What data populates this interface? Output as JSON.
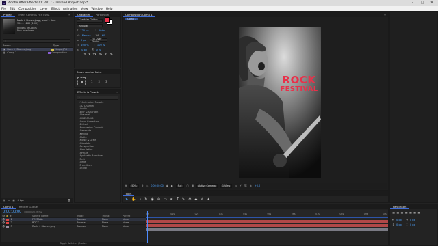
{
  "titlebar": {
    "logo": "Ae",
    "title": "Adobe After Effects CC 2017 - Untitled Project.aep *",
    "min": "–",
    "max": "□",
    "close": "✕"
  },
  "menu": [
    "File",
    "Edit",
    "Composition",
    "Layer",
    "Effect",
    "Animation",
    "View",
    "Window",
    "Help"
  ],
  "project": {
    "tabs": [
      "Project",
      "Effect Controls FESTIVAL"
    ],
    "asset_name": "Rock + Stones.jpeg , used 1 time",
    "asset_dims": "720 x 1280 (1.00)",
    "asset_depth": "Millions of Colors",
    "asset_mode": "Non-Interlaced",
    "search_placeholder": "⌕",
    "col_name": "Name",
    "col_type": "Type",
    "items": [
      {
        "name": "Rock + Stones.jpeg",
        "type": "ImporJPG",
        "color": "#d4c04a"
      },
      {
        "name": "Comp 1",
        "type": "Composition",
        "color": "#8a5fd6"
      }
    ],
    "footer": "8 bpc"
  },
  "character": {
    "tabs": [
      "Character",
      "Paragraph"
    ],
    "font": "Cheddar Gothic ...",
    "style": "Regular",
    "size": "120 px",
    "leading": "Auto",
    "kerning": "Metrics",
    "tracking": "-60",
    "stroke": "0 px",
    "stroke_mode": "Fill Over Stroke",
    "vscale": "100 %",
    "hscale": "100 %",
    "baseline": "0 px",
    "tsume": "0 %",
    "styles_row": [
      "T",
      "T",
      "TT",
      "Tt",
      "T¹",
      "T₁"
    ]
  },
  "motion": {
    "title": "Move Anchor Point",
    "values": [
      "1",
      "2",
      "3"
    ]
  },
  "effects": {
    "tabs": [
      "Effects & Presets"
    ],
    "search_placeholder": "⌕",
    "items": [
      "* Animation Presets",
      "3D Channel",
      "Audio",
      "Blur & Sharpen",
      "Channel",
      "CINEMA 4D",
      "Color Correction",
      "Distort",
      "Expression Controls",
      "Generate",
      "Keying",
      "Matte",
      "Noise & Grain",
      "Obsolete",
      "Perspective",
      "Simulation",
      "Stylize",
      "Synthetic Aperture",
      "Text",
      "Time",
      "Transition",
      "Utility"
    ]
  },
  "composition": {
    "tabs": [
      "Composition Comp 1"
    ],
    "breadcrumb": "Comp 1",
    "poster_title1": "ROCK",
    "poster_title2": "FESTIVAL",
    "zoom": "50%",
    "timecode": "0;00;00;00",
    "resolution": "Full",
    "camera": "Active Camera",
    "views": "1 View",
    "offset": "+0.0"
  },
  "tools_panel": {
    "title": "Tools"
  },
  "timeline": {
    "tabs": [
      "Comp 1",
      "Render Queue"
    ],
    "timecode": "0;00;00;00",
    "fps": "00000 (29.97 fps)",
    "col_source": "Source Name",
    "col_mode": "Mode",
    "col_trkmat": "TrkMat",
    "col_parent": "Parent",
    "layers": [
      {
        "num": "1",
        "name": "FESTIVAL",
        "mode": "Normal",
        "trk": "None",
        "parent": "None",
        "color": "#e04444"
      },
      {
        "num": "2",
        "name": "ROCK",
        "mode": "Normal",
        "trk": "None",
        "parent": "None",
        "color": "#e04444"
      },
      {
        "num": "3",
        "name": "Rock + Stones.jpeg",
        "mode": "Normal",
        "trk": "None",
        "parent": "None",
        "color": "#9b8fa0"
      }
    ],
    "ruler": [
      "0s",
      "01s",
      "02s",
      "03s",
      "04s",
      "05s",
      "06s",
      "07s",
      "08s",
      "09s",
      "10s"
    ],
    "footer": "Toggle Switches / Modes"
  },
  "paragraph": {
    "tabs": [
      "Paragraph"
    ],
    "indent_a": "0 px",
    "indent_b": "0 px",
    "space_a": "0 px",
    "space_b": "0 px"
  },
  "colors": {
    "accent": "#3d6bd8",
    "poster_red": "#e8314a",
    "layer_red": "#b04848",
    "layer_gray": "#7a7a84"
  }
}
